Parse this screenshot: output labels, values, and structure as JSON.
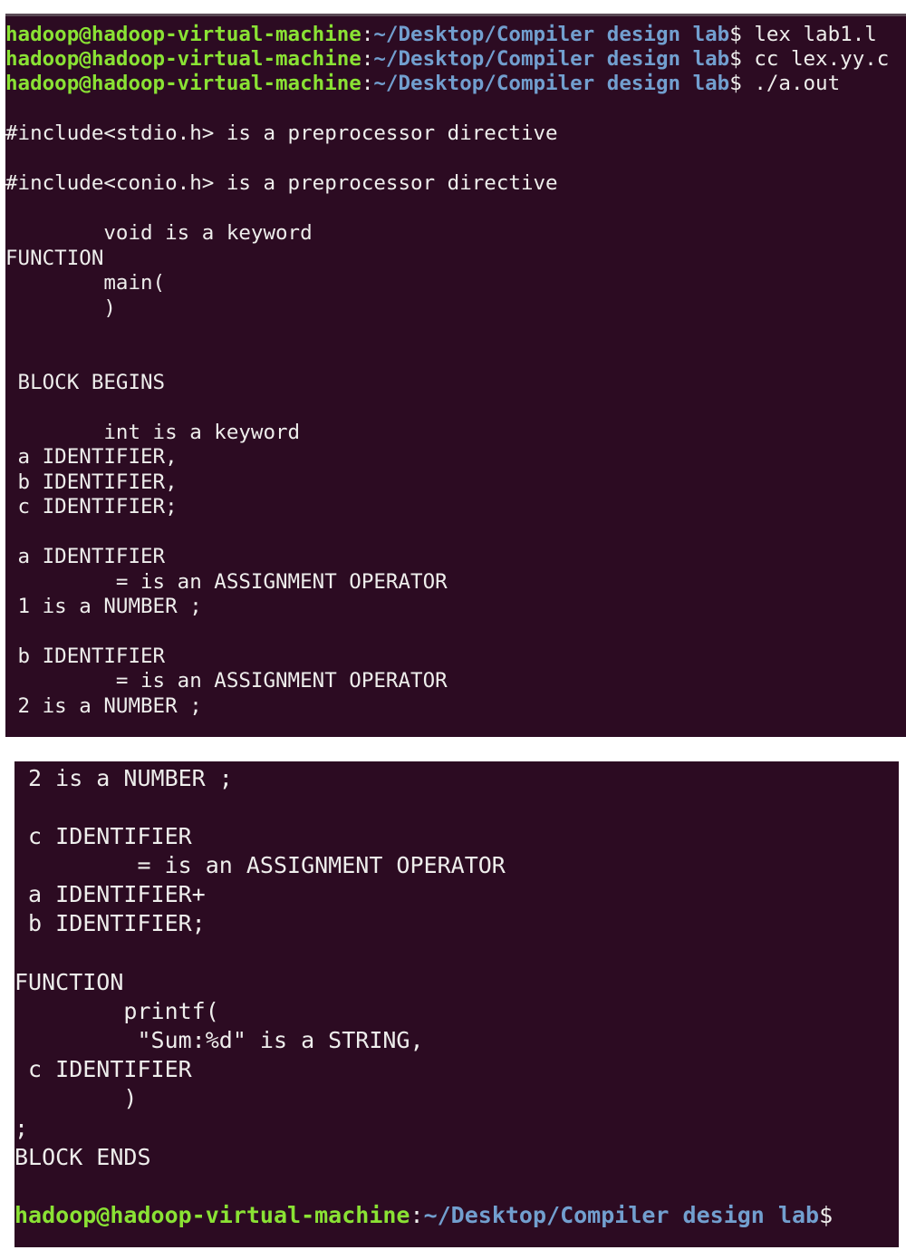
{
  "colors": {
    "background": "#2c0b22",
    "text": "#eeeeec",
    "prompt_user": "#8ae234",
    "prompt_path": "#729fcf"
  },
  "prompt": {
    "user_host": "hadoop@hadoop-virtual-machine",
    "colon": ":",
    "path": "~/Desktop/Compiler design lab",
    "dollar": "$"
  },
  "panel1": {
    "commands": [
      " lex lab1.l",
      " cc lex.yy.c",
      " ./a.out"
    ],
    "output": [
      "#include<stdio.h> is a preprocessor directive",
      "#include<conio.h> is a preprocessor directive",
      "        void is a keyword",
      "FUNCTION",
      "        main(",
      "        )",
      " BLOCK BEGINS",
      "        int is a keyword",
      " a IDENTIFIER,",
      " b IDENTIFIER,",
      " c IDENTIFIER;",
      " a IDENTIFIER",
      "         = is an ASSIGNMENT OPERATOR",
      " 1 is a NUMBER ;",
      " b IDENTIFIER",
      "         = is an ASSIGNMENT OPERATOR",
      " 2 is a NUMBER ;"
    ]
  },
  "panel2": {
    "output": [
      " 2 is a NUMBER ;",
      " c IDENTIFIER",
      "         = is an ASSIGNMENT OPERATOR",
      " a IDENTIFIER+",
      " b IDENTIFIER;",
      "FUNCTION",
      "        printf(",
      "         \"Sum:%d\" is a STRING,",
      " c IDENTIFIER",
      "        )",
      ";",
      "BLOCK ENDS"
    ]
  }
}
